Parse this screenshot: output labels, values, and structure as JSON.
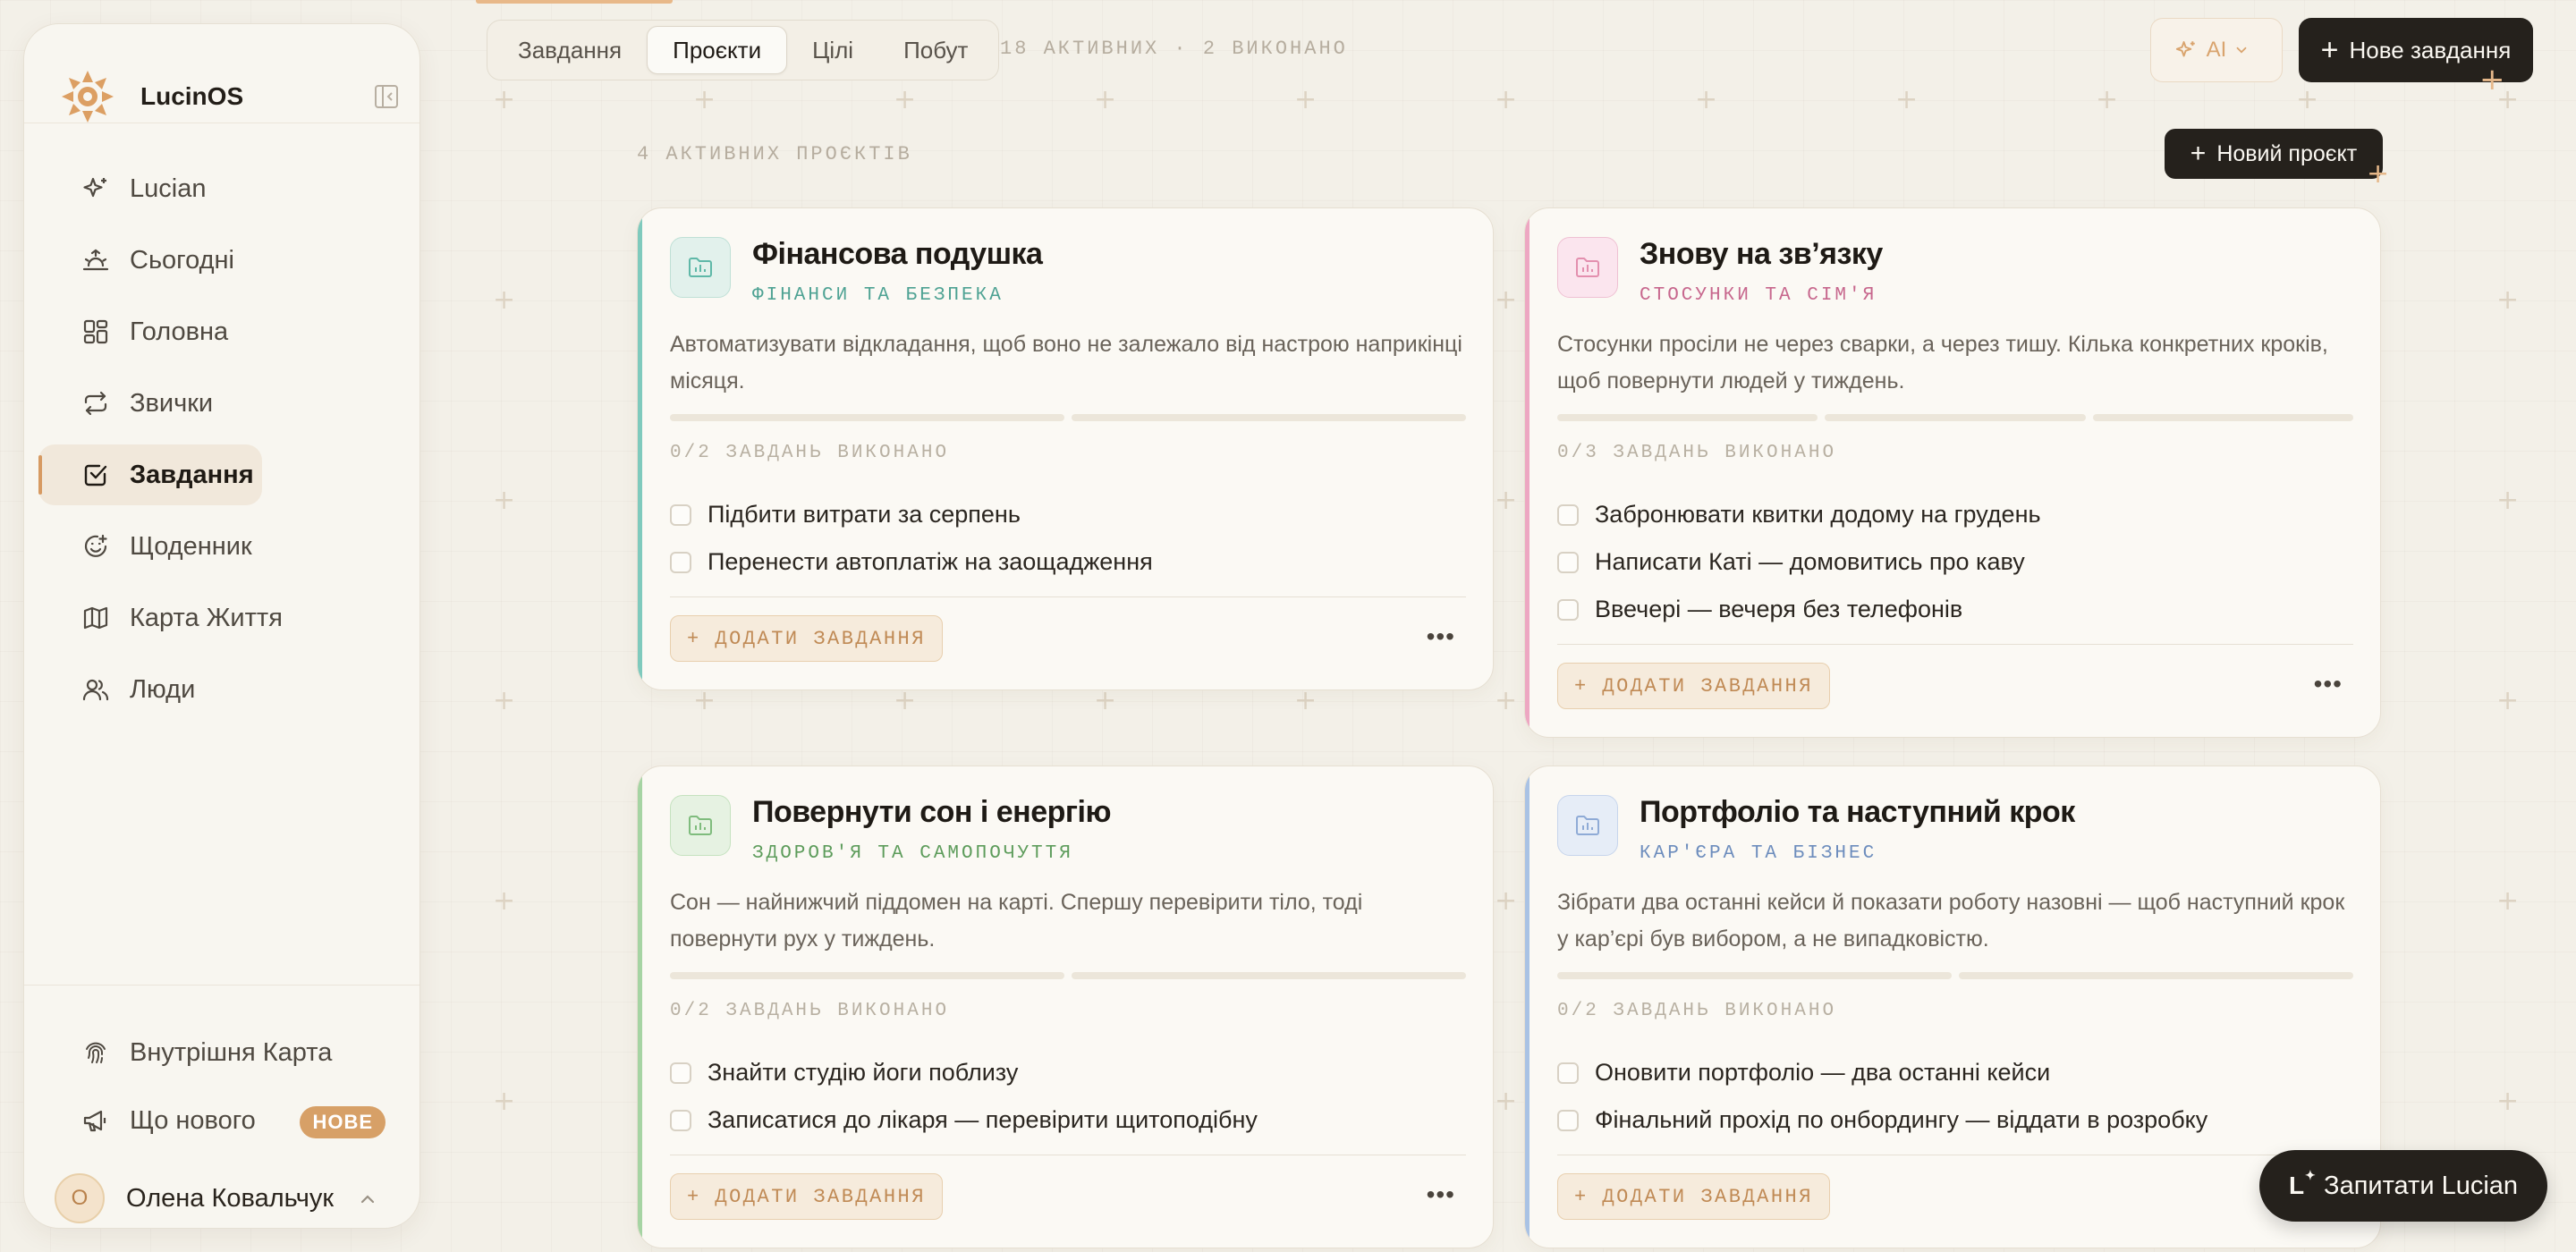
{
  "app": {
    "name": "LucinOS"
  },
  "sidebar": {
    "items": [
      {
        "label": "Lucian",
        "icon": "sparkles-icon"
      },
      {
        "label": "Сьогодні",
        "icon": "sunrise-icon"
      },
      {
        "label": "Головна",
        "icon": "dashboard-icon"
      },
      {
        "label": "Звички",
        "icon": "repeat-icon"
      },
      {
        "label": "Завдання",
        "icon": "checkbox-icon",
        "active": true
      },
      {
        "label": "Щоденник",
        "icon": "smile-plus-icon"
      },
      {
        "label": "Карта Життя",
        "icon": "map-icon"
      },
      {
        "label": "Люди",
        "icon": "users-icon"
      }
    ],
    "bottom": [
      {
        "label": "Внутрішня Карта",
        "icon": "fingerprint-icon"
      },
      {
        "label": "Що нового",
        "icon": "megaphone-icon",
        "badge": "НОВЕ"
      }
    ],
    "user": {
      "initial": "О",
      "name": "Олена Ковальчук"
    }
  },
  "header": {
    "tabs": [
      "Завдання",
      "Проєкти",
      "Цілі",
      "Побут"
    ],
    "active_tab": "Проєкти",
    "status": "18 АКТИВНИХ · 2 ВИКОНАНО",
    "ai_label": "AI",
    "new_task": "Нове завдання"
  },
  "main": {
    "projects_count": "4 АКТИВНИХ ПРОЄКТІВ",
    "new_project": "Новий проєкт",
    "add_task_label": "+ ДОДАТИ ЗАВДАННЯ",
    "projects": [
      {
        "title": "Фінансова подушка",
        "category": "ФІНАНСИ ТА БЕЗПЕКА",
        "description": "Автоматизувати відкладання, щоб воно не залежало від настрою наприкінці місяця.",
        "done_label": "0/2 ЗАВДАНЬ ВИКОНАНО",
        "tasks": [
          "Підбити витрати за серпень",
          "Перенести автоплатіж на заощадження"
        ]
      },
      {
        "title": "Знову на зв’язку",
        "category": "СТОСУНКИ ТА СІМ'Я",
        "description": "Стосунки просіли не через сварки, а через тишу. Кілька конкретних кроків, щоб повернути людей у тиждень.",
        "done_label": "0/3 ЗАВДАНЬ ВИКОНАНО",
        "tasks": [
          "Забронювати квитки додому на грудень",
          "Написати Каті — домовитись про каву",
          "Ввечері — вечеря без телефонів"
        ]
      },
      {
        "title": "Повернути сон і енергію",
        "category": "ЗДОРОВ'Я ТА САМОПОЧУТТЯ",
        "description": "Сон — найнижчий піддомен на карті. Спершу перевірити тіло, тоді повернути рух у тиждень.",
        "done_label": "0/2 ЗАВДАНЬ ВИКОНАНО",
        "tasks": [
          "Знайти студію йоги поблизу",
          "Записатися до лікаря — перевірити щитоподібну"
        ]
      },
      {
        "title": "Портфоліо та наступний крок",
        "category": "КАР'ЄРА ТА БІЗНЕС",
        "description": "Зібрати два останні кейси й показати роботу назовні — щоб наступний крок у кар’єрі був вибором, а не випадковістю.",
        "done_label": "0/2 ЗАВДАНЬ ВИКОНАНО",
        "tasks": [
          "Оновити портфоліо — два останні кейси",
          "Фінальний прохід по онбордингу — віддати в розробку"
        ]
      }
    ]
  },
  "ask_button": "Запитати Lucian",
  "colors": {
    "accent_orange": "#d79a62",
    "dark_button": "#25211c",
    "finance": "#5fb8a8",
    "relationships": "#e38fae",
    "health": "#8cc48c",
    "career": "#95b1d9"
  }
}
